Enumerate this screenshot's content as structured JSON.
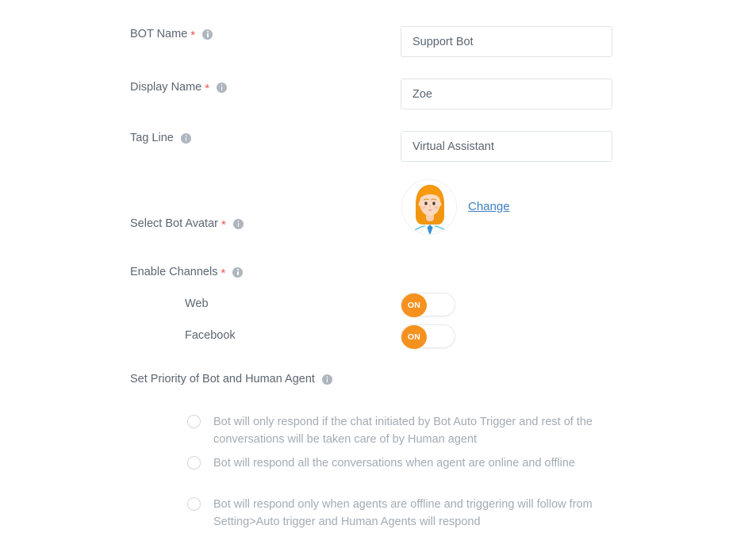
{
  "form": {
    "fields": [
      {
        "label": "BOT Name",
        "required": true,
        "has_info_icon": true,
        "value": "Support Bot",
        "placeholder": "BOT Name"
      },
      {
        "label": "Display Name",
        "required": true,
        "has_info_icon": true,
        "value": "Zoe",
        "placeholder": "Display Name"
      },
      {
        "label": "Tag Line",
        "required": false,
        "has_info_icon": true,
        "value": "Virtual Assistant",
        "placeholder": "Tag Line"
      }
    ],
    "avatar": {
      "label": "Select Bot Avatar",
      "required": true,
      "has_info_icon": true,
      "change_label": "Change",
      "avatar_icon": "female-avatar-icon"
    },
    "channels": {
      "label": "Enable Channels",
      "required": true,
      "has_info_icon": true,
      "items": [
        {
          "name": "Web",
          "state_label": "ON",
          "enabled": true
        },
        {
          "name": "Facebook",
          "state_label": "ON",
          "enabled": true
        }
      ]
    },
    "priority": {
      "label": "Set Priority of Bot and Human Agent",
      "required": false,
      "has_info_icon": true,
      "options": [
        {
          "text": "Bot will only respond if the chat initiated by Bot Auto Trigger and rest of the conversations will be taken care of by Human agent",
          "selected": false
        },
        {
          "text": "Bot will respond all the conversations when agent are online and offline",
          "selected": false
        },
        {
          "text": "Bot will respond only when agents are offline and triggering will follow from Setting>Auto trigger and Human Agents will respond",
          "selected": false
        }
      ]
    }
  },
  "colors": {
    "accent_orange": "#f5911e",
    "required_red": "#f4524d",
    "link_blue": "#3c7fc1",
    "label_grey": "#5c6670",
    "muted_grey": "#a3abb4",
    "border_grey": "#e0e4e8",
    "info_icon_grey": "#aeb6bf"
  }
}
